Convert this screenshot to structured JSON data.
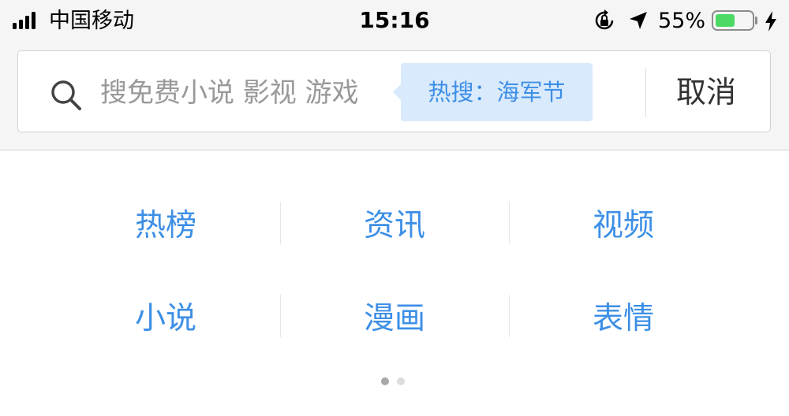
{
  "status_bar": {
    "carrier": "中国移动",
    "time": "15:16",
    "battery_percent": "55%",
    "battery_level": 0.55,
    "icons": [
      "signal-icon",
      "orientation-lock-icon",
      "location-arrow-icon",
      "battery-icon",
      "charging-bolt-icon"
    ]
  },
  "search": {
    "placeholder": "搜免费小说 影视 游戏",
    "hot_tip": "热搜：海军节",
    "cancel_label": "取消",
    "icon": "search-icon"
  },
  "categories": [
    [
      "热榜",
      "资讯",
      "视频"
    ],
    [
      "小说",
      "漫画",
      "表情"
    ]
  ],
  "pagination": {
    "total": 2,
    "current": 1
  },
  "colors": {
    "accent": "#3d8fe6",
    "hot_tip_bg": "#d9eafc",
    "battery_fill": "#4cd964",
    "header_bg": "#f5f5f5"
  }
}
